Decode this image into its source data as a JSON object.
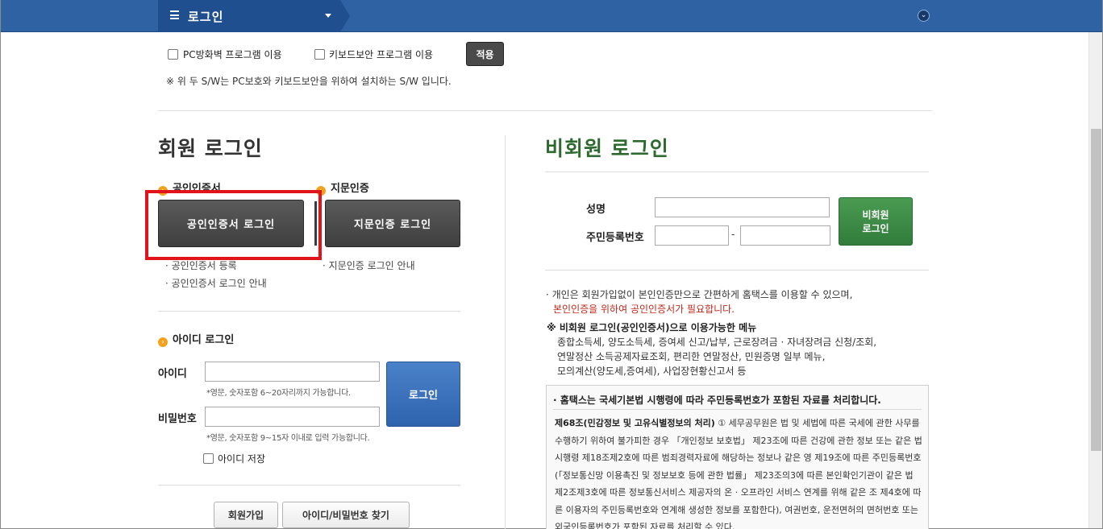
{
  "topbar": {
    "menu_title": "로그인"
  },
  "security": {
    "firewall_label": "PC방화벽 프로그램 이용",
    "keyboard_label": "키보드보안 프로그램 이용",
    "apply_label": "적용",
    "note": "※ 위 두 S/W는 PC보호와 키보드보안을 위하여 설치하는 S/W 입니다."
  },
  "member": {
    "heading": "회원 로그인",
    "cert_head": "공인인증서",
    "finger_head": "지문인증",
    "cert_button": "공인인증서 로그인",
    "finger_button": "지문인증 로그인",
    "cert_register": "· 공인인증서 등록",
    "cert_guide": "· 공인인증서 로그인 안내",
    "finger_guide": "· 지문인증 로그인 안내",
    "id_head": "아이디 로그인",
    "id_label": "아이디",
    "id_hint": "*영문, 숫자포함 6~20자리까지 가능합니다.",
    "pw_label": "비밀번호",
    "pw_hint": "*영문, 숫자포함 9~15자 이내로 입력 가능합니다.",
    "login_button": "로그인",
    "save_id_label": "아이디 저장",
    "join_button": "회원가입",
    "find_button": "아이디/비밀번호 찾기"
  },
  "guest": {
    "heading": "비회원 로그인",
    "name_label": "성명",
    "rrn_label": "주민등록번호",
    "dash": "-",
    "login_line1": "비회원",
    "login_line2": "로그인",
    "info1": "· 개인은 회원가입없이 본인인증만으로 간편하게 홈택스를 이용할 수 있으며,",
    "info2": "본인인증을 위하여 공인인증서가 필요합니다.",
    "menu_title": "※ 비회원 로그인(공인인증서)으로 이용가능한 메뉴",
    "menu1": "종합소득세, 양도소득세, 증여세 신고/납부, 근로장려금 · 자녀장려금 신청/조회,",
    "menu2": "연말정산 소득공제자료조회, 편리한 연말정산, 민원증명 일부 메뉴,",
    "menu3": "모의계산(양도세,증여세), 사업장현황신고서 등",
    "law_title": "· 홈택스는 국세기본법 시행령에 따라 주민등록번호가 포함된 자료를 처리합니다.",
    "law_bold": "제68조(민감정보 및 고유식별정보의 처리)",
    "law_body": " ① 세무공무원은 법 및 세법에 따른 국세에 관한 사무를 수행하기 위하여 불가피한 경우 「개인정보 보호법」 제23조에 따른 건강에 관한 정보 또는 같은 법 시행령 제18조제2호에 따른 범죄경력자료에 해당하는 정보나 같은 영 제19조에 따른 주민등록번호(「정보통신망 이용촉진 및 정보보호 등에 관한 법률」 제23조의3에 따른 본인확인기관이 같은 법 제2조제3호에 따른 정보통신서비스 제공자의 온 · 오프라인 서비스 연계를 위해 같은 조 제4호에 따른 이용자의 주민등록번호와 연계해 생성한 정보를 포함한다), 여권번호, 운전면허의 면허번호 또는 외국인등록번호가 포함된 자료를 처리할 수 있다."
  }
}
